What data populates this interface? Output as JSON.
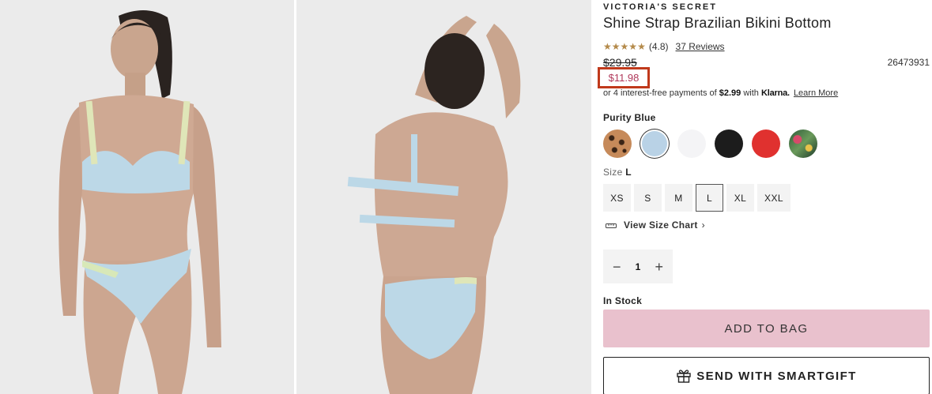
{
  "product": {
    "brand": "VICTORIA'S SECRET",
    "title": "Shine Strap Brazilian Bikini Bottom",
    "rating_value": "(4.8)",
    "rating_stars": 4.8,
    "reviews_label": "37 Reviews",
    "original_price": "$29.95",
    "sale_price": "$11.98",
    "sku": "26473931",
    "klarna": {
      "prefix": "or 4 interest-free payments of",
      "amount": "$2.99",
      "with": "with",
      "brand": "Klarna.",
      "learn_more": "Learn More"
    }
  },
  "color": {
    "selected_name": "Purity Blue",
    "swatches": [
      {
        "name": "leopard",
        "color": "#c68a5a"
      },
      {
        "name": "purity-blue",
        "color": "#b9d2e6",
        "selected": true
      },
      {
        "name": "white",
        "color": "#f4f4f6"
      },
      {
        "name": "black",
        "color": "#1c1c1c"
      },
      {
        "name": "red",
        "color": "#e0312f"
      },
      {
        "name": "tropical-print",
        "color": "#3d6b4a"
      }
    ]
  },
  "size": {
    "label": "Size",
    "selected": "L",
    "options": [
      "XS",
      "S",
      "M",
      "L",
      "XL",
      "XXL"
    ],
    "size_chart_label": "View Size Chart"
  },
  "quantity": {
    "minus": "−",
    "value": "1",
    "plus": "+"
  },
  "stock_status": "In Stock",
  "buttons": {
    "add_to_bag": "ADD TO BAG",
    "smartgift": "SEND WITH SMARTGIFT"
  },
  "images": {
    "front_alt": "front-view-model-image",
    "back_alt": "back-view-model-image"
  }
}
